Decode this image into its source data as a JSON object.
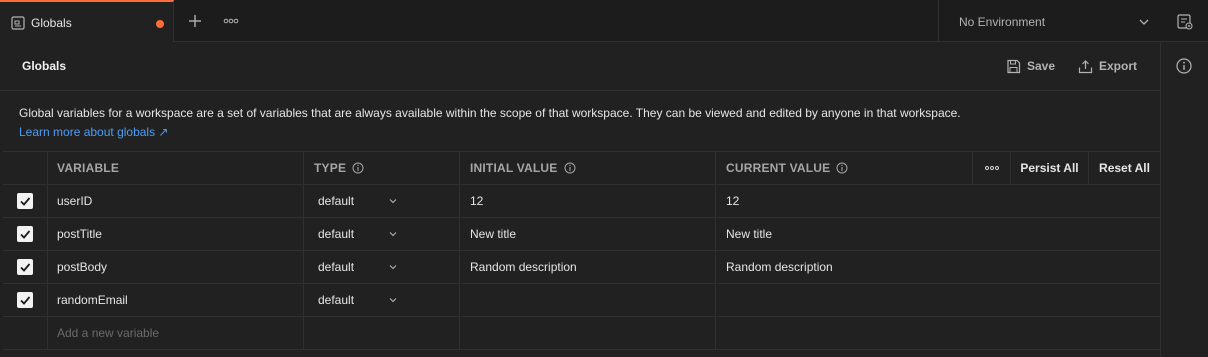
{
  "tab": {
    "label": "Globals"
  },
  "environment": {
    "label": "No Environment"
  },
  "header": {
    "title": "Globals",
    "save_label": "Save",
    "export_label": "Export"
  },
  "description": {
    "text": "Global variables for a workspace are a set of variables that are always available within the scope of that workspace. They can be viewed and edited by anyone in that workspace.",
    "link": "Learn more about globals ↗"
  },
  "table": {
    "columns": {
      "variable": "VARIABLE",
      "type": "TYPE",
      "initial": "INITIAL VALUE",
      "current": "CURRENT VALUE",
      "persist_all": "Persist All",
      "reset_all": "Reset All"
    },
    "rows": [
      {
        "variable": "userID",
        "type": "default",
        "initial": "12",
        "current": "12",
        "checked": true
      },
      {
        "variable": "postTitle",
        "type": "default",
        "initial": "New title",
        "current": "New title",
        "checked": true
      },
      {
        "variable": "postBody",
        "type": "default",
        "initial": "Random description",
        "current": "Random description",
        "checked": true
      },
      {
        "variable": "randomEmail",
        "type": "default",
        "initial": "",
        "current": "",
        "checked": true
      }
    ],
    "new_placeholder": "Add a new variable"
  },
  "colors": {
    "accent": "#ff6c37",
    "link": "#4c9df5",
    "background": "#212121"
  }
}
